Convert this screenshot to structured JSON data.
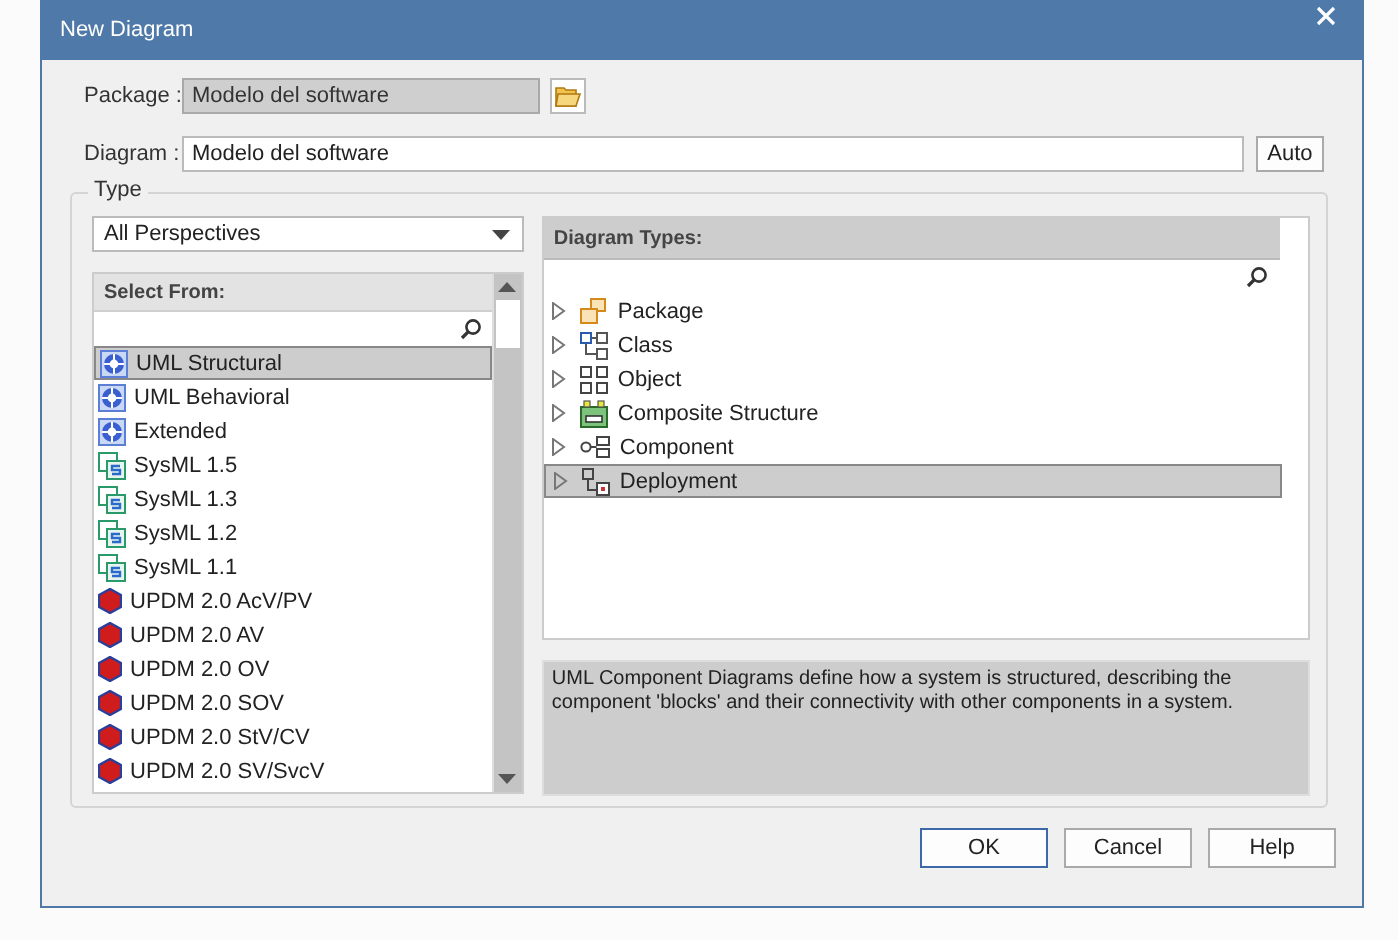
{
  "window": {
    "title": "New Diagram"
  },
  "package": {
    "label": "Package :",
    "value": "Modelo del software",
    "disabled": true
  },
  "diagram": {
    "label": "Diagram :",
    "value": "Modelo del software",
    "auto_button": "Auto"
  },
  "type_group": {
    "label": "Type",
    "perspective": {
      "value": "All Perspectives"
    },
    "select_from": {
      "header": "Select From:",
      "items": [
        {
          "label": "UML Structural",
          "kind": "uml",
          "selected": true
        },
        {
          "label": "UML Behavioral",
          "kind": "uml",
          "selected": false
        },
        {
          "label": "Extended",
          "kind": "uml",
          "selected": false
        },
        {
          "label": "SysML 1.5",
          "kind": "sysml",
          "selected": false
        },
        {
          "label": "SysML 1.3",
          "kind": "sysml",
          "selected": false
        },
        {
          "label": "SysML 1.2",
          "kind": "sysml",
          "selected": false
        },
        {
          "label": "SysML 1.1",
          "kind": "sysml",
          "selected": false
        },
        {
          "label": "UPDM 2.0 AcV/PV",
          "kind": "updm",
          "selected": false
        },
        {
          "label": "UPDM 2.0 AV",
          "kind": "updm",
          "selected": false
        },
        {
          "label": "UPDM 2.0 OV",
          "kind": "updm",
          "selected": false
        },
        {
          "label": "UPDM 2.0 SOV",
          "kind": "updm",
          "selected": false
        },
        {
          "label": "UPDM 2.0 StV/CV",
          "kind": "updm",
          "selected": false
        },
        {
          "label": "UPDM 2.0 SV/SvcV",
          "kind": "updm",
          "selected": false
        }
      ]
    },
    "diagram_types": {
      "header": "Diagram Types:",
      "items": [
        {
          "label": "Package",
          "kind": "package",
          "expanded": false,
          "selected": false
        },
        {
          "label": "Class",
          "kind": "class",
          "expanded": false,
          "selected": false
        },
        {
          "label": "Object",
          "kind": "object",
          "expanded": false,
          "selected": false
        },
        {
          "label": "Composite Structure",
          "kind": "composite",
          "expanded": false,
          "selected": false
        },
        {
          "label": "Component",
          "kind": "component",
          "expanded": false,
          "selected": false
        },
        {
          "label": "Deployment",
          "kind": "deployment",
          "expanded": false,
          "selected": true
        }
      ]
    },
    "description": "UML Component Diagrams define how a system is structured, describing the component 'blocks' and their connectivity with other components in a system."
  },
  "buttons": [
    {
      "label": "OK",
      "default": true
    },
    {
      "label": "Cancel",
      "default": false
    },
    {
      "label": "Help",
      "default": false
    }
  ]
}
